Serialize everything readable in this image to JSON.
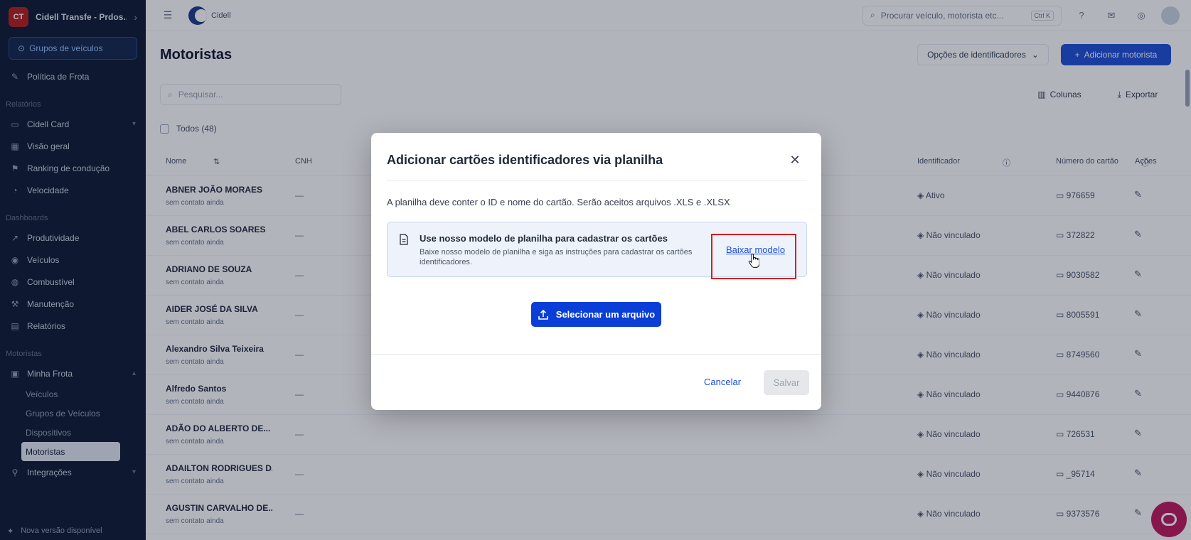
{
  "sidebar": {
    "company": "Cidell Transfe - Prdos...",
    "logo_text": "CT",
    "group_button": "Grupos de veículos",
    "top_items": [
      {
        "label": "Política de Frota",
        "icon": "pin-icon"
      }
    ],
    "sections": [
      {
        "title": "Relatórios",
        "items": [
          {
            "label": "Cidell Card",
            "icon": "card-icon",
            "tail": "▾"
          },
          {
            "label": "Visão geral",
            "icon": "grid-icon",
            "tail": ""
          },
          {
            "label": "Ranking de condução",
            "icon": "trophy-icon",
            "tail": ""
          },
          {
            "label": "Velocidade",
            "icon": "gauge-icon",
            "tail": ""
          }
        ]
      },
      {
        "title": "Dashboards",
        "items": [
          {
            "label": "Produtividade",
            "icon": "chart-icon",
            "tail": ""
          },
          {
            "label": "Veículos",
            "icon": "car-icon",
            "tail": ""
          },
          {
            "label": "Combustível",
            "icon": "fuel-icon",
            "tail": ""
          },
          {
            "label": "Manutenção",
            "icon": "wrench-icon",
            "tail": ""
          },
          {
            "label": "Relatórios",
            "icon": "doc-icon",
            "tail": ""
          }
        ]
      },
      {
        "title": "Motoristas",
        "items": [
          {
            "label": "Minha Frota",
            "icon": "truck-icon",
            "tail": "▴"
          }
        ]
      }
    ],
    "sub_items": [
      "Veículos",
      "Grupos de Veículos",
      "Dispositivos",
      "Motoristas"
    ],
    "active_sub_index": 3,
    "bottom_items": [
      {
        "label": "Integrações",
        "icon": "plug-icon",
        "tail": "▾"
      }
    ],
    "footer": "Nova versão disponível"
  },
  "topbar": {
    "brand": "Cidell",
    "search_placeholder": "Procurar veículo, motorista etc...",
    "search_kbd": "Ctrl K"
  },
  "page": {
    "title": "Motoristas",
    "secondary_button": "Opções de identificadores",
    "primary_button": "Adicionar motorista",
    "search_placeholder": "Pesquisar...",
    "columns_button": "Colunas",
    "export_button": "Exportar",
    "selection_label": "Todos (48)",
    "table_headers": [
      "Nome",
      "CNH",
      "Identificador",
      "Número do cartão",
      "Ações"
    ]
  },
  "rows": [
    {
      "name": "ABNER JOÃO MORAES",
      "sub": "sem contato ainda",
      "id_label": "Ativo",
      "card": "976659"
    },
    {
      "name": "ABEL CARLOS SOARES",
      "sub": "sem contato ainda",
      "id_label": "Não vinculado",
      "card": "372822"
    },
    {
      "name": "ADRIANO DE SOUZA",
      "sub": "sem contato ainda",
      "id_label": "Não vinculado",
      "card": "9030582"
    },
    {
      "name": "AIDER JOSÉ DA SILVA",
      "sub": "sem contato ainda",
      "id_label": "Não vinculado",
      "card": "8005591"
    },
    {
      "name": "Alexandro Silva Teixeira",
      "sub": "sem contato ainda",
      "id_label": "Não vinculado",
      "card": "8749560"
    },
    {
      "name": "Alfredo Santos",
      "sub": "sem contato ainda",
      "id_label": "Não vinculado",
      "card": "9440876"
    },
    {
      "name": "ADÃO DO ALBERTO DE...",
      "sub": "sem contato ainda",
      "id_label": "Não vinculado",
      "card": "726531"
    },
    {
      "name": "ADAILTON RODRIGUES DA C...",
      "sub": "sem contato ainda",
      "id_label": "Não vinculado",
      "card": "_95714"
    },
    {
      "name": "AGUSTIN CARVALHO DE...",
      "sub": "sem contato ainda",
      "id_label": "Não vinculado",
      "card": "9373576"
    }
  ],
  "modal": {
    "title": "Adicionar cartões identificadores via planilha",
    "description": "A planilha deve conter o ID e nome do cartão. Serão aceitos arquivos .XLS e .XLSX",
    "info_title": "Use nosso modelo de planilha para cadastrar os cartões",
    "info_text": "Baixe nosso modelo de planilha e siga as instruções para cadastrar os cartões identificadores.",
    "download_link": "Baixar modelo",
    "upload_button": "Selecionar um arquivo",
    "cancel_button": "Cancelar",
    "save_button": "Salvar"
  },
  "colors": {
    "primary": "#0a3ed6",
    "sidebar_bg": "#0e1a33",
    "highlight": "#d91c1c",
    "chat": "#be185d"
  }
}
